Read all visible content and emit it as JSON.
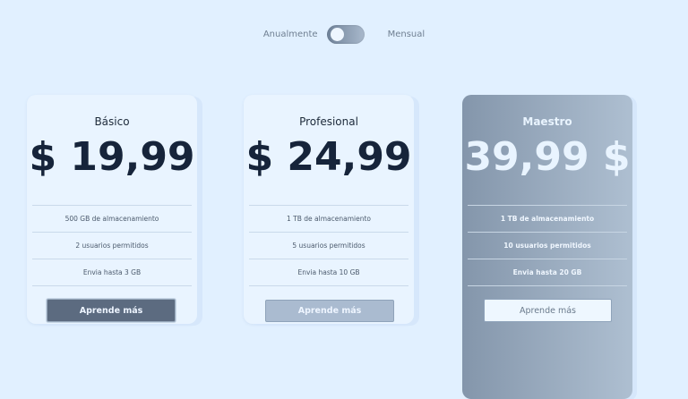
{
  "billing_toggle": {
    "left_label": "Anualmente",
    "right_label": "Mensual"
  },
  "plans": [
    {
      "name": "Básico",
      "price": "$ 19,99",
      "features": [
        "500 GB de almacenamiento",
        "2 usuarios permitidos",
        "Envia hasta 3 GB"
      ],
      "cta": "Aprende más"
    },
    {
      "name": "Profesional",
      "price": "$ 24,99",
      "features": [
        "1 TB de almacenamiento",
        "5 usuarios permitidos",
        "Envia hasta 10 GB"
      ],
      "cta": "Aprende más"
    },
    {
      "name": "Maestro",
      "price": "39,99 $",
      "features": [
        "1 TB de almacenamiento",
        "10 usuarios permitidos",
        "Envia hasta 20 GB"
      ],
      "cta": "Aprende más"
    }
  ],
  "colors": {
    "background": "#e1f0ff",
    "card": "#e9f4ff",
    "featured_card_gradient_start": "#8496ab",
    "featured_card_gradient_end": "#aebfd1",
    "price_text": "#16243a"
  }
}
